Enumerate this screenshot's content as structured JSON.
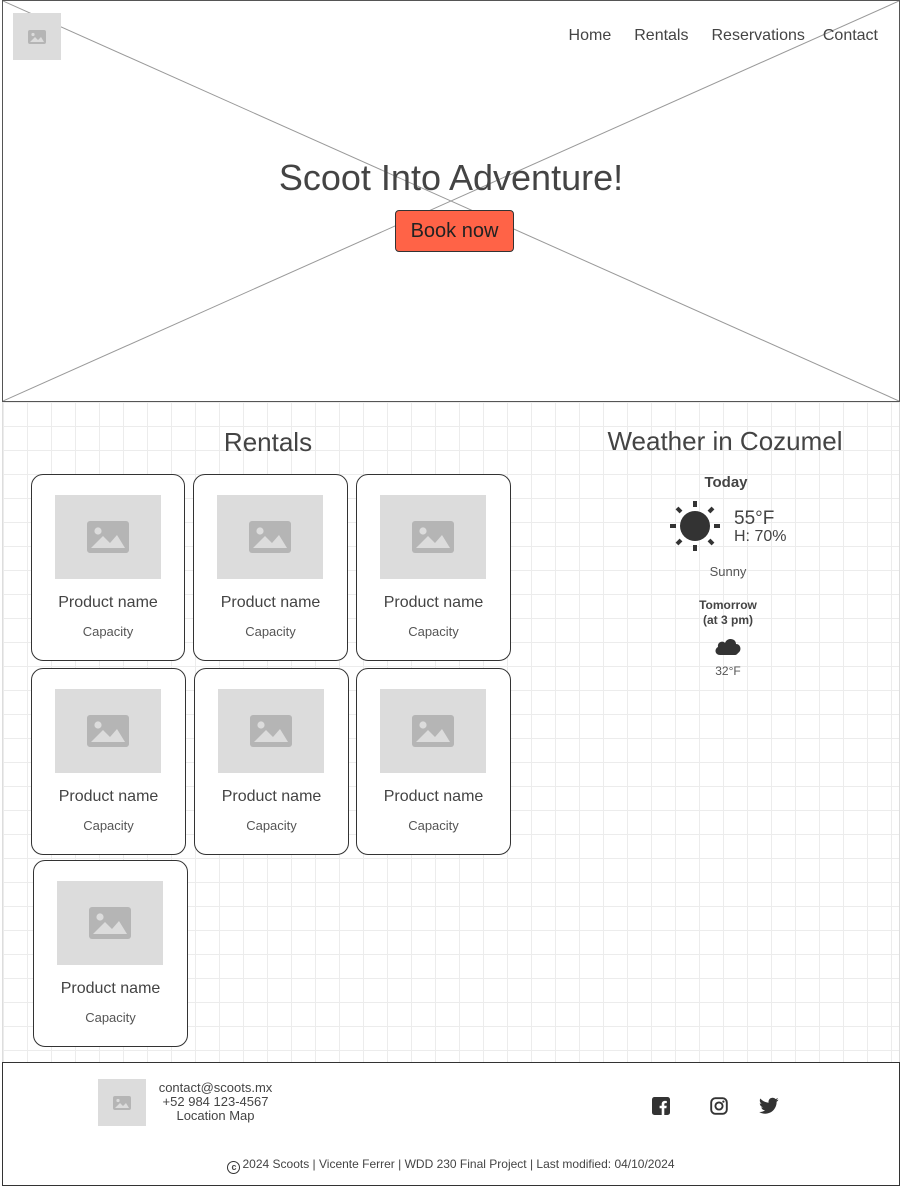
{
  "nav": {
    "items": [
      {
        "label": "Home"
      },
      {
        "label": "Rentals"
      },
      {
        "label": "Reservations"
      },
      {
        "label": "Contact"
      }
    ]
  },
  "hero": {
    "title": "Scoot Into Adventure!",
    "button_label": "Book now"
  },
  "rentals": {
    "title": "Rentals",
    "cards": [
      {
        "name": "Product name",
        "capacity": "Capacity"
      },
      {
        "name": "Product name",
        "capacity": "Capacity"
      },
      {
        "name": "Product name",
        "capacity": "Capacity"
      },
      {
        "name": "Product name",
        "capacity": "Capacity"
      },
      {
        "name": "Product name",
        "capacity": "Capacity"
      },
      {
        "name": "Product name",
        "capacity": "Capacity"
      },
      {
        "name": "Product name",
        "capacity": "Capacity"
      }
    ]
  },
  "weather": {
    "title": "Weather in Cozumel",
    "today_label": "Today",
    "temperature": "55°F",
    "humidity": "H: 70%",
    "condition": "Sunny",
    "tomorrow_label_line1": "Tomorrow",
    "tomorrow_label_line2": "(at 3 pm)",
    "tomorrow_temperature": "32°F",
    "today_icon": "sun-icon",
    "tomorrow_icon": "cloud-icon"
  },
  "footer": {
    "email": "contact@scoots.mx",
    "phone": "+52 984 123-4567",
    "map_link": "Location Map",
    "social": [
      "facebook-icon",
      "instagram-icon",
      "twitter-icon"
    ],
    "copyright": "2024 Scoots | Vicente Ferrer | WDD 230 Final Project |  Last modified: 04/10/2024"
  },
  "colors": {
    "accent": "#ff6347",
    "placeholder": "#dcdcdc",
    "text": "#444444"
  }
}
